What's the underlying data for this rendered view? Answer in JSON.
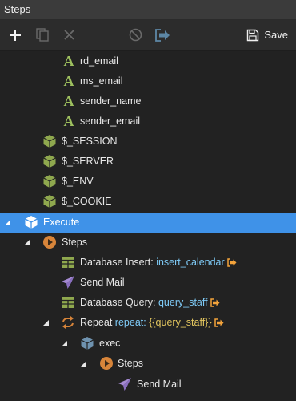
{
  "window": {
    "title": "Steps"
  },
  "toolbar": {
    "save_label": "Save"
  },
  "tree": {
    "vars": [
      "rd_email",
      "ms_email",
      "sender_name",
      "sender_email"
    ],
    "globals": [
      "$_SESSION",
      "$_SERVER",
      "$_ENV",
      "$_COOKIE"
    ],
    "execute": "Execute",
    "steps": "Steps",
    "db_insert": {
      "label": "Database Insert:",
      "value": "insert_calendar"
    },
    "send_mail": "Send Mail",
    "db_query": {
      "label": "Database Query:",
      "value": "query_staff"
    },
    "repeat": {
      "label": "Repeat",
      "key": "repeat:",
      "value": "{{query_staff}}"
    },
    "exec": "exec",
    "inner_steps": "Steps",
    "inner_send_mail": "Send Mail"
  }
}
